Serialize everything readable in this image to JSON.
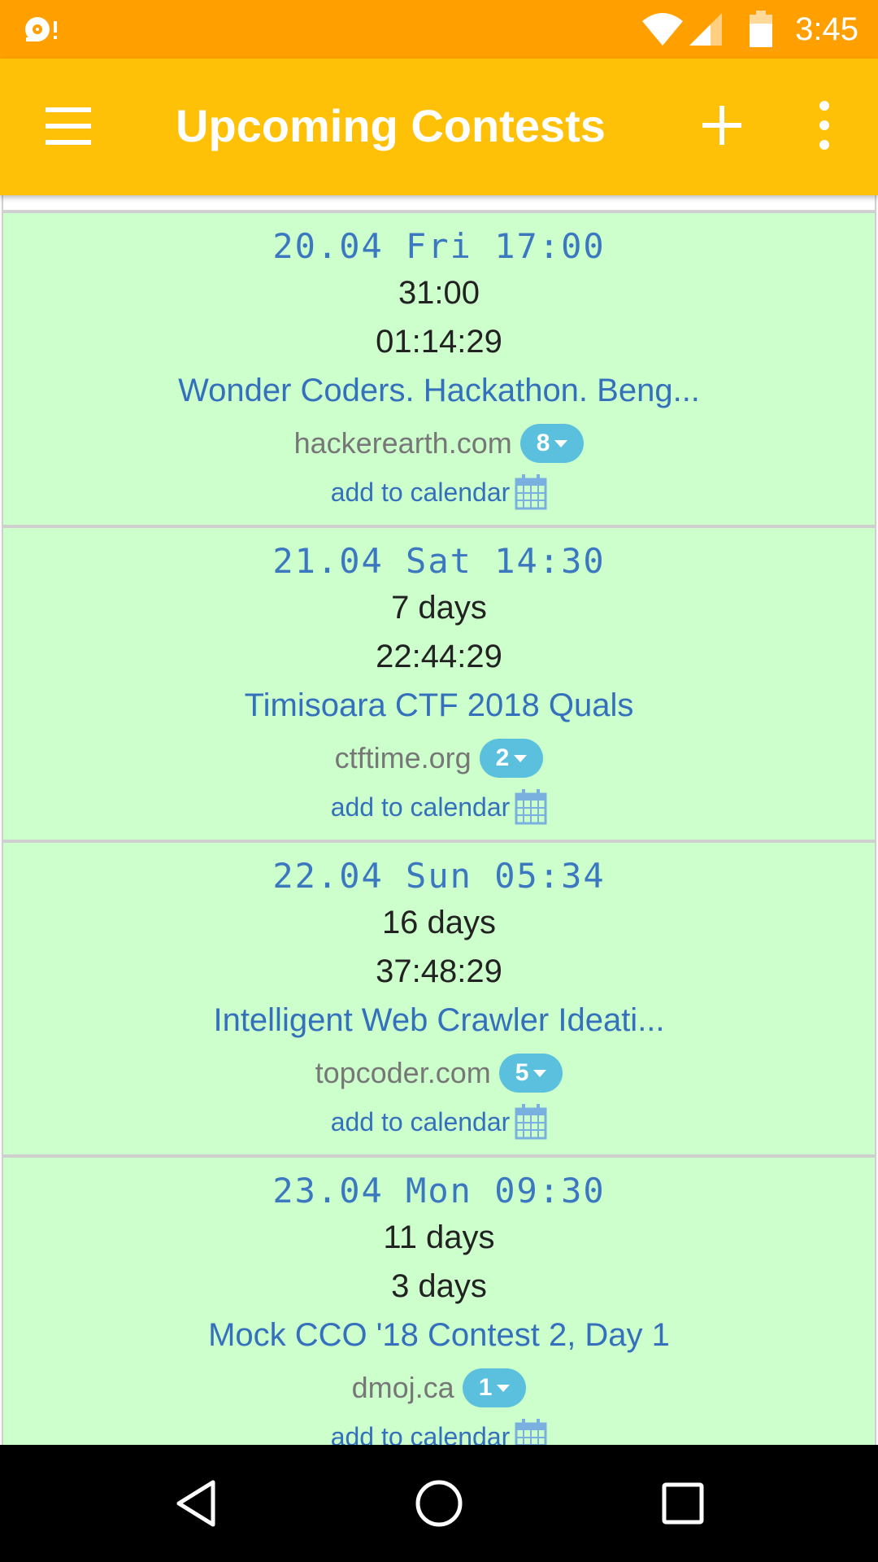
{
  "status_bar": {
    "time": "3:45",
    "icons": [
      "notification-icon",
      "wifi-icon",
      "signal-icon",
      "battery-icon"
    ],
    "color": "#ffa000"
  },
  "app_bar": {
    "title": "Upcoming Contests",
    "color": "#ffc107",
    "icons": [
      "menu-icon",
      "add-icon",
      "more-vert-icon"
    ]
  },
  "contests": [
    {
      "date": "20.04 Fri 17:00",
      "duration": "31:00",
      "time_left": "01:14:29",
      "name": "Wonder Coders. Hackathon. Beng...",
      "site": "hackerearth.com",
      "badge": "8",
      "calendar_label": "add to calendar"
    },
    {
      "date": "21.04 Sat 14:30",
      "duration": "7 days",
      "time_left": "22:44:29",
      "name": "Timisoara CTF 2018 Quals",
      "site": "ctftime.org",
      "badge": "2",
      "calendar_label": "add to calendar"
    },
    {
      "date": "22.04 Sun 05:34",
      "duration": "16 days",
      "time_left": "37:48:29",
      "name": "Intelligent Web Crawler Ideati...",
      "site": "topcoder.com",
      "badge": "5",
      "calendar_label": "add to calendar"
    },
    {
      "date": "23.04 Mon 09:30",
      "duration": "11 days",
      "time_left": "3 days",
      "name": "Mock CCO '18 Contest 2, Day 1",
      "site": "dmoj.ca",
      "badge": "1",
      "calendar_label": "add to calendar"
    }
  ],
  "colors": {
    "card_bg": "#ccffcc",
    "link": "#3470bc",
    "badge": "#5bc0de"
  },
  "nav_bar": {
    "icons": [
      "back-icon",
      "home-icon",
      "recents-icon"
    ]
  }
}
